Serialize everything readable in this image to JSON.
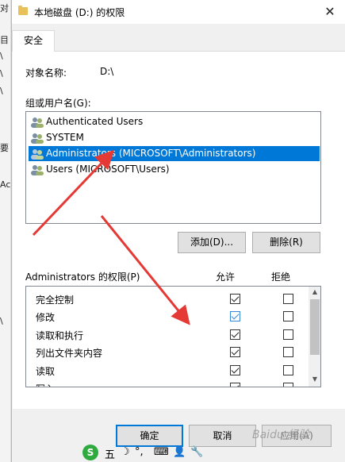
{
  "background_window": {
    "edge_texts": [
      "对",
      "目",
      "\\",
      "\\",
      "\\",
      "要",
      "Ac",
      "\\"
    ]
  },
  "dialog": {
    "title": "本地磁盘 (D:) 的权限",
    "close_glyph": "✕",
    "tab_security": "安全",
    "object_name_label": "对象名称:",
    "object_name_value": "D:\\",
    "group_users_label": "组或用户名(G):",
    "users": [
      {
        "name": "Authenticated Users",
        "selected": false
      },
      {
        "name": "SYSTEM",
        "selected": false
      },
      {
        "name": "Administrators (MICROSOFT\\Administrators)",
        "selected": true
      },
      {
        "name": "Users (MICROSOFT\\Users)",
        "selected": false
      }
    ],
    "add_button": "添加(D)...",
    "remove_button": "删除(R)",
    "permissions_label": "Administrators 的权限(P)",
    "allow_header": "允许",
    "deny_header": "拒绝",
    "permissions": [
      {
        "name": "完全控制",
        "allow": true,
        "deny": false
      },
      {
        "name": "修改",
        "allow": true,
        "deny": false
      },
      {
        "name": "读取和执行",
        "allow": true,
        "deny": false
      },
      {
        "name": "列出文件夹内容",
        "allow": true,
        "deny": false
      },
      {
        "name": "读取",
        "allow": true,
        "deny": false
      },
      {
        "name": "写入",
        "allow": true,
        "deny": false
      }
    ],
    "ok_button": "确定",
    "cancel_button": "取消",
    "apply_button": "应用(A)"
  },
  "ime_toolbar": {
    "items": [
      "五",
      "☽",
      "°,",
      "⌨",
      "👤",
      "🔧"
    ]
  },
  "watermark": "Baidu 经验",
  "colors": {
    "selection": "#0078d7",
    "annotation_arrow": "#e53935"
  }
}
